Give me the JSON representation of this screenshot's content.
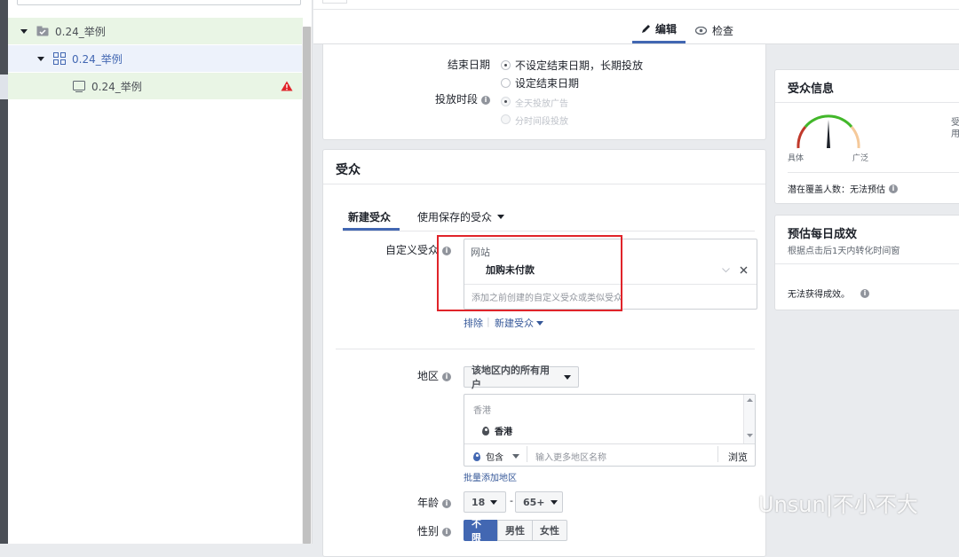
{
  "tree": {
    "items": [
      {
        "label": "0.24_举例",
        "level": 0
      },
      {
        "label": "0.24_举例",
        "level": 1
      },
      {
        "label": "0.24_举例",
        "level": 2
      }
    ]
  },
  "header": {
    "tabs": [
      {
        "label": "编辑"
      },
      {
        "label": "检查"
      }
    ]
  },
  "schedule": {
    "end_date_label": "结束日期",
    "end_options": [
      "不设定结束日期，长期投放",
      "设定结束日期"
    ],
    "time_label": "投放时段",
    "time_options": [
      "全天投放广告",
      "分时间段投放"
    ]
  },
  "audience": {
    "title": "受众",
    "tabs": [
      "新建受众",
      "使用保存的受众"
    ],
    "custom_label": "自定义受众",
    "custom_group": "网站",
    "custom_item": "加购未付款",
    "custom_placeholder": "添加之前创建的自定义受众或类似受众",
    "exclude_link": "排除",
    "new_link": "新建受众",
    "region_label": "地区",
    "region_dropdown": "该地区内的所有用户",
    "region_group": "香港",
    "region_item": "香港",
    "include_select": "包含",
    "region_placeholder": "输入更多地区名称",
    "browse": "浏览",
    "bulk_link": "批量添加地区",
    "age_label": "年龄",
    "age_min": "18",
    "age_sep": "-",
    "age_max": "65+",
    "gender_label": "性别",
    "genders": [
      "不限",
      "男性",
      "女性"
    ]
  },
  "audience_info": {
    "title": "受众信息",
    "gauge_left": "具体",
    "gauge_right": "广泛",
    "side_text_1": "受",
    "side_text_2": "用",
    "reach": "潜在覆盖人数：无法预估"
  },
  "daily": {
    "title": "预估每日成效",
    "subtitle": "根据点击后1天内转化时间窗",
    "status": "无法获得成效。"
  },
  "watermark": "Unsun|不小不大",
  "colors": {
    "accent": "#4267b2",
    "highlight_box": "#e0242a",
    "warning": "#e0242a",
    "tree_selected_bg": "#e9f5e5"
  }
}
